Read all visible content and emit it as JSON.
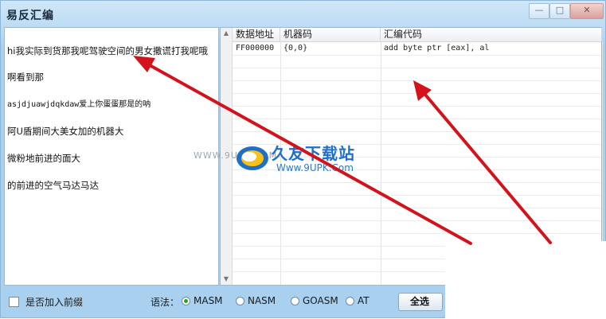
{
  "window": {
    "title": "易反汇编",
    "controls": {
      "minimize": "—",
      "maximize": "□",
      "close": "✕"
    }
  },
  "editor": {
    "lines": [
      "hi我实际到货那我呢驾驶空间的男女撒谎打我呢哦",
      "啊看到那",
      "asjdjuawjdqkdaw爱上你蛋蛋那是的呐",
      "阿U盾期间大美女加的机器大",
      "微粉地前进的面大",
      "的前进的空气马达马达"
    ]
  },
  "table": {
    "headers": [
      "数据地址",
      "机器码",
      "汇编代码"
    ],
    "rows": [
      {
        "address": "FF000000",
        "machine_code": "{0,0}",
        "asm": "add byte ptr [eax], al"
      }
    ]
  },
  "watermark": {
    "url_text": "WWW.9UPK.COM",
    "name": "久友下载站",
    "sub": "Www.9UPK.Com"
  },
  "bottom": {
    "prefix_checkbox_label": "是否加入前缀",
    "prefix_checked": false,
    "grammar_label": "语法：",
    "syntax_options": [
      "MASM",
      "NASM",
      "GOASM",
      "AT"
    ],
    "selected_syntax": "MASM",
    "select_all_label": "全选"
  },
  "colors": {
    "titlebar_bg": "#cfe6f8",
    "arrow": "#d3121b",
    "radio_selected": "#1fa81f",
    "watermark_blue": "#1f6fc7"
  }
}
